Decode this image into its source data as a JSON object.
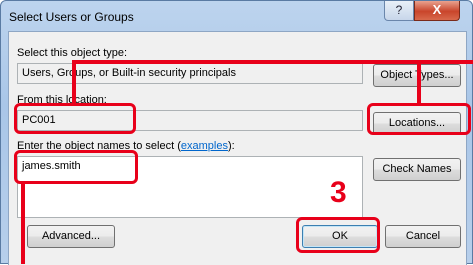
{
  "window": {
    "title": "Select Users or Groups",
    "help_glyph": "?",
    "close_glyph": "X"
  },
  "object_type": {
    "label": "Select this object type:",
    "value": "Users, Groups, or Built-in security principals",
    "button": "Object Types..."
  },
  "location": {
    "label": "From this location:",
    "value": "PC001",
    "button": "Locations..."
  },
  "names": {
    "label_prefix": "Enter the object names to select (",
    "label_link": "examples",
    "label_suffix": "):",
    "value": "james.smith",
    "check_button": "Check Names"
  },
  "footer": {
    "advanced_button": "Advanced...",
    "ok_button": "OK",
    "cancel_button": "Cancel"
  },
  "annotation": {
    "step_number": "3",
    "color": "#e8001a"
  },
  "icons": {
    "help": "help-icon",
    "close": "close-icon"
  }
}
